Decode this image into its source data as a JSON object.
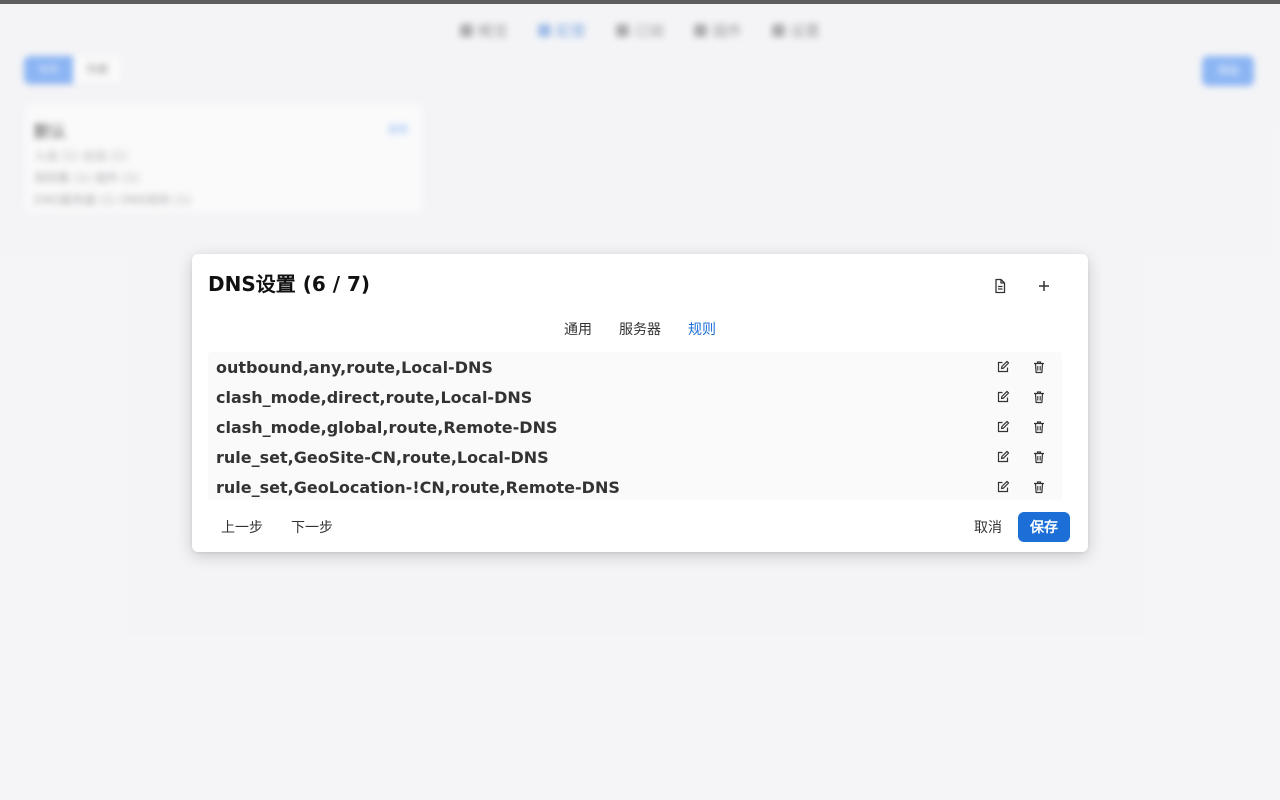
{
  "background": {
    "nav": [
      {
        "label": "概览",
        "icon": "overview-icon"
      },
      {
        "label": "配置",
        "icon": "profiles-icon",
        "active": true
      },
      {
        "label": "订阅",
        "icon": "subscriptions-icon"
      },
      {
        "label": "插件",
        "icon": "plugins-icon"
      },
      {
        "label": "设置",
        "icon": "settings-icon"
      }
    ],
    "view_toggle": [
      "卡片",
      "列表"
    ],
    "action_button": "添加",
    "card": {
      "title": "默认",
      "tag": "使用",
      "lines": [
        "入站 (1) 出站 (1)",
        "规则集 (1) 插件 (1)",
        "DNS服务器 (1) DNS规则 (1)"
      ]
    }
  },
  "modal": {
    "title": "DNS设置 (6 / 7)",
    "tabs": [
      "通用",
      "服务器",
      "规则"
    ],
    "active_tab": "规则",
    "rules": [
      "outbound,any,route,Local-DNS",
      "clash_mode,direct,route,Local-DNS",
      "clash_mode,global,route,Remote-DNS",
      "rule_set,GeoSite-CN,route,Local-DNS",
      "rule_set,GeoLocation-!CN,route,Remote-DNS"
    ],
    "footer": {
      "prev": "上一步",
      "next": "下一步",
      "cancel": "取消",
      "save": "保存"
    }
  },
  "colors": {
    "accent": "#1d6fd8",
    "background": "#f5f5f7",
    "surface": "#ffffff"
  }
}
